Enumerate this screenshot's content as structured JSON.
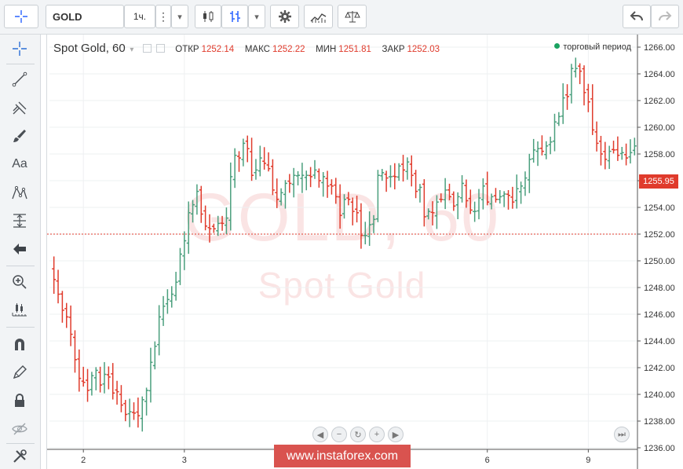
{
  "toolbar": {
    "symbol": "GOLD",
    "interval": "1ч.",
    "menu_dots": "⋮",
    "dropdown_arrow": "▾",
    "icons": [
      "crosshair-icon",
      "candles-icon",
      "bars-icon",
      "gear-icon",
      "indicators-icon",
      "compare-icon",
      "undo-icon",
      "redo-icon"
    ]
  },
  "legend": {
    "symbol_label": "Spot Gold, 60",
    "open_label": "ОТКР",
    "open": "1252.14",
    "high_label": "МАКС",
    "high": "1252.22",
    "low_label": "МИН",
    "low": "1251.81",
    "close_label": "ЗАКР",
    "close": "1252.03",
    "session_label": "торговый период"
  },
  "watermark": {
    "line1": "GOLD, 60",
    "line2": "Spot Gold"
  },
  "current_price": "1255.95",
  "brand": "www.instaforex.com",
  "colors": {
    "up": "#4a9f7d",
    "down": "#e03b2c",
    "accent": "#2962ff"
  },
  "chart_data": {
    "type": "ohlc",
    "series_name": "Spot Gold",
    "y_ticks": [
      "1236.00",
      "1238.00",
      "1240.00",
      "1242.00",
      "1244.00",
      "1246.00",
      "1248.00",
      "1250.00",
      "1252.00",
      "1254.00",
      "1256.00",
      "1258.00",
      "1260.00",
      "1262.00",
      "1264.00",
      "1266.00"
    ],
    "ylim": [
      1236,
      1267
    ],
    "x_ticks": [
      {
        "label": "2",
        "index": 7
      },
      {
        "label": "3",
        "index": 31
      },
      {
        "label": "6",
        "index": 103
      },
      {
        "label": "9",
        "index": 127
      }
    ],
    "dashed_level": 1252.0,
    "bars_count": 139,
    "closes": [
      1248.6,
      1247.5,
      1246.3,
      1245.8,
      1244.5,
      1242.6,
      1241.2,
      1240.9,
      1240.3,
      1241.4,
      1241.8,
      1240.7,
      1241.5,
      1241.3,
      1240.1,
      1240.2,
      1239.2,
      1238.5,
      1238.7,
      1238.6,
      1238.4,
      1239.6,
      1240.3,
      1242.4,
      1243.6,
      1245.8,
      1246.6,
      1247.1,
      1247.5,
      1248.4,
      1250.5,
      1251.5,
      1253.6,
      1254.2,
      1255.2,
      1253.5,
      1252.6,
      1252.4,
      1252.4,
      1252.8,
      1252.8,
      1253.2,
      1256.3,
      1257.9,
      1257.7,
      1258.8,
      1258.4,
      1256.4,
      1256.8,
      1257.7,
      1257.3,
      1256.9,
      1255.3,
      1254.6,
      1255.1,
      1255.8,
      1255.8,
      1256.4,
      1256.4,
      1256.4,
      1256.4,
      1256.3,
      1256.8,
      1256.0,
      1256.3,
      1255.6,
      1255.6,
      1254.8,
      1253.4,
      1254.6,
      1254.6,
      1253.7,
      1253.6,
      1251.9,
      1251.9,
      1252.7,
      1253.1,
      1256.4,
      1256.6,
      1256.2,
      1256.3,
      1256.3,
      1257.1,
      1256.8,
      1257.4,
      1256.4,
      1255.2,
      1255.5,
      1253.3,
      1253.7,
      1253.6,
      1254.4,
      1254.6,
      1255.3,
      1254.8,
      1254.1,
      1254.8,
      1255.8,
      1254.5,
      1253.8,
      1253.7,
      1254.7,
      1255.6,
      1254.4,
      1254.8,
      1254.6,
      1254.8,
      1255.0,
      1254.9,
      1254.4,
      1255.4,
      1255.6,
      1256.2,
      1257.6,
      1258.3,
      1258.4,
      1258.2,
      1258.6,
      1258.9,
      1260.4,
      1260.8,
      1262.2,
      1262.3,
      1264.4,
      1264.4,
      1264.2,
      1262.6,
      1261.9,
      1259.8,
      1258.8,
      1258.0,
      1257.6,
      1258.2,
      1258.3,
      1257.9,
      1258.1,
      1257.7,
      1258.1,
      1258.6,
      1259.6,
      1259.1,
      1257.9,
      1256.9,
      1256.0
    ]
  }
}
